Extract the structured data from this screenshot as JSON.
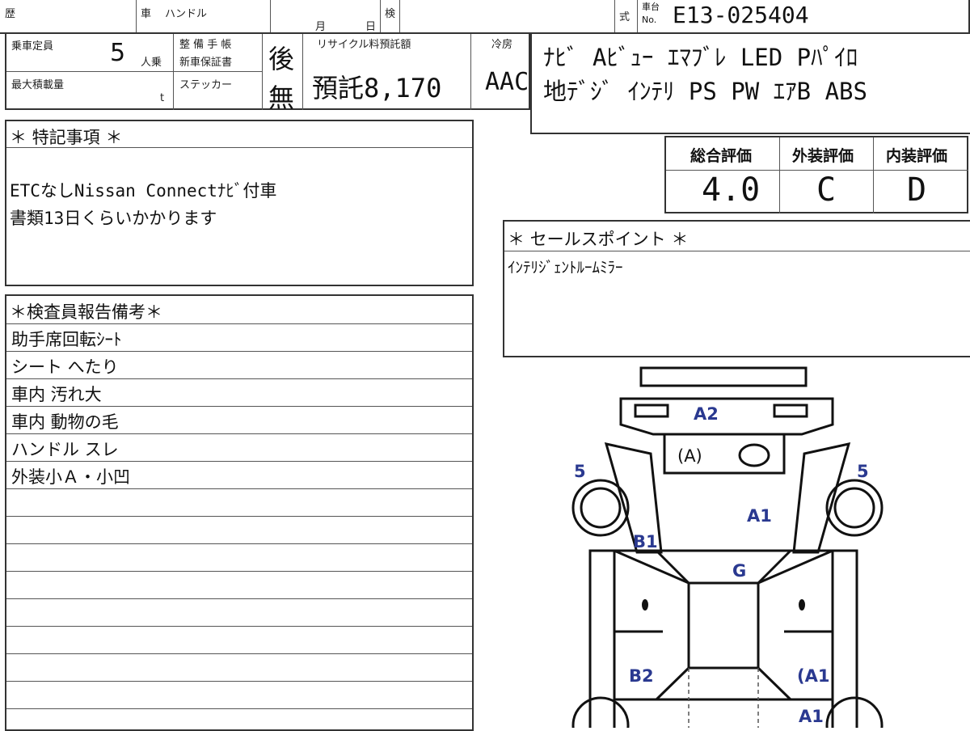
{
  "header": {
    "history_label": "歴",
    "car_label": "車",
    "handle_label": "ハンドル",
    "month_label": "月",
    "day_label": "日",
    "inspection_label": "検",
    "type_label": "式",
    "chassis_label_top": "車台",
    "chassis_label_bottom": "No.",
    "chassis_number": "E13-025404"
  },
  "specs": {
    "capacity_label": "乗車定員",
    "capacity_value": "5",
    "capacity_unit": "人乗",
    "maintenance_label_1": "整 備 手 帳",
    "maintenance_label_2": "新車保証書",
    "maintenance_value": "後",
    "sticker_label": "ステッカー",
    "sticker_value": "無",
    "max_load_label": "最大積載量",
    "max_load_unit": "t",
    "recycle_label": "リサイクル料預託額",
    "recycle_value": "預託8,170",
    "cooling_label": "冷房",
    "cooling_value": "AAC"
  },
  "equipment": {
    "line1": "ﾅﾋﾞ Aﾋﾞｭｰ ｴﾏﾌﾞﾚ LED Pﾊﾟｲﾛ",
    "line2": "地ﾃﾞｼﾞ ｲﾝﾃﾘ PS PW ｴｱB ABS"
  },
  "special_notes": {
    "title": "＊ 特記事項 ＊",
    "line1": "ETCなしNissan Connectﾅﾋﾞ付車",
    "line2": "書類13日くらいかかります"
  },
  "grades": {
    "overall_label": "総合評価",
    "overall_value": "4.0",
    "exterior_label": "外装評価",
    "exterior_value": "C",
    "interior_label": "内装評価",
    "interior_value": "D"
  },
  "sales_point": {
    "title": "＊ セールスポイント ＊",
    "text": "ｲﾝﾃﾘｼﾞｪﾝﾄﾙｰﾑﾐﾗｰ"
  },
  "inspector_report": {
    "title": "＊検査員報告備考＊",
    "rows": [
      "助手席回転ｼｰﾄ",
      "シート へたり",
      "車内 汚れ大",
      "車内 動物の毛",
      "ハンドル スレ",
      "外装小Ａ・小凹"
    ]
  },
  "diagram": {
    "marks": [
      "A2",
      "(A)",
      "5",
      "5",
      "A1",
      "B1",
      "G",
      "B2",
      "(A1",
      "A1"
    ],
    "mark_color": "#2a3990"
  }
}
